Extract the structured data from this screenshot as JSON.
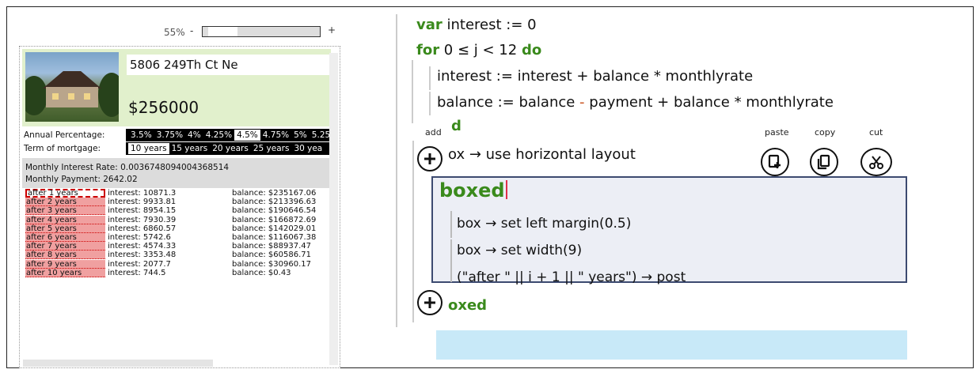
{
  "zoom": {
    "label": "55%",
    "minus": "-",
    "plus": "+",
    "value_fraction": 0.25
  },
  "listing": {
    "address": "5806 249Th Ct Ne",
    "price": "$256000"
  },
  "annual_percentage": {
    "label": "Annual Percentage:",
    "options": [
      "3.5%",
      "3.75%",
      "4%",
      "4.25%",
      "4.5%",
      "4.75%",
      "5%",
      "5.25"
    ],
    "selected": "4.5%"
  },
  "term": {
    "label": "Term of mortgage:",
    "options": [
      "10 years",
      "15 years",
      "20 years",
      "25 years",
      "30 yea"
    ],
    "selected": "10 years"
  },
  "summary": {
    "rate": "Monthly Interest Rate: 0.0036748094004368514",
    "payment": "Monthly Payment: 2642.02"
  },
  "schedule": [
    {
      "year": "after 1 years",
      "interest": "interest: 10871.3",
      "balance": "balance: $235167.06"
    },
    {
      "year": "after 2 years",
      "interest": "interest: 9933.81",
      "balance": "balance: $213396.63"
    },
    {
      "year": "after 3 years",
      "interest": "interest: 8954.15",
      "balance": "balance: $190646.54"
    },
    {
      "year": "after 4 years",
      "interest": "interest: 7930.39",
      "balance": "balance: $166872.69"
    },
    {
      "year": "after 5 years",
      "interest": "interest: 6860.57",
      "balance": "balance: $142029.01"
    },
    {
      "year": "after 6 years",
      "interest": "interest: 5742.6",
      "balance": "balance: $116067.38"
    },
    {
      "year": "after 7 years",
      "interest": "interest: 4574.33",
      "balance": "balance: $88937.47"
    },
    {
      "year": "after 8 years",
      "interest": "interest: 3353.48",
      "balance": "balance: $60586.71"
    },
    {
      "year": "after 9 years",
      "interest": "interest: 2077.7",
      "balance": "balance: $30960.17"
    },
    {
      "year": "after 10 years",
      "interest": "interest: 744.5",
      "balance": "balance: $0.43"
    }
  ],
  "code": {
    "line1_kw": "var",
    "line1_rest": " interest := 0",
    "line2_kw1": "for",
    "line2_mid": " 0 ≤ j < 12 ",
    "line2_kw2": "do",
    "line3": "interest := interest + balance * monthlyrate",
    "line4_a": "balance := balance ",
    "line4_minus": "-",
    "line4_b": " payment + balance * monthlyrate",
    "line5_partial": "d",
    "line6_rest": "ox → use horizontal layout",
    "boxed_title": "boxed",
    "boxed_lines": [
      "box → set left margin(0.5)",
      "box → set width(9)",
      "(\"after \" || i + 1 || \" years\") → post"
    ],
    "line_bottom_rest": "oxed"
  },
  "actions": {
    "add": "add",
    "paste": "paste",
    "copy": "copy",
    "cut": "cut"
  }
}
